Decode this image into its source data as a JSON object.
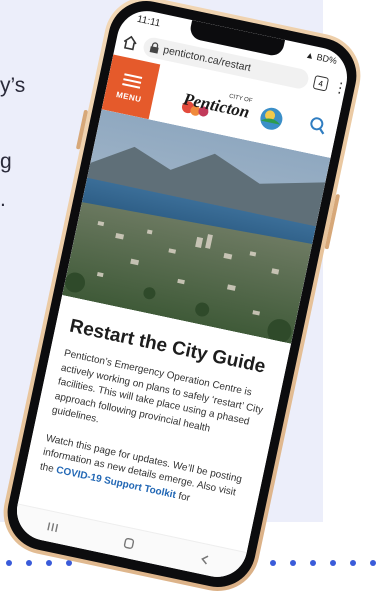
{
  "background": {
    "panel_color": "#eceefa",
    "dot_color": "#3a5bd9",
    "side_text_fragments": [
      "y’s",
      "g",
      "."
    ]
  },
  "phone": {
    "status_bar": {
      "time": "11:11",
      "battery": "BD%"
    },
    "browser": {
      "url": "penticton.ca/restart",
      "tab_count": "4"
    },
    "site_header": {
      "menu_label": "MENU",
      "logo_small_text": "CITY OF",
      "logo_text": "Penticton",
      "accent_color": "#e55a2b"
    },
    "page": {
      "title": "Restart the City Guide",
      "paragraph1": "Penticton’s Emergency Operation Centre is actively working on plans to safely ‘restart’ City facilities. This will take place using a phased approach following provincial health guidelines.",
      "paragraph2_prefix": "Watch this page for updates. We’ll be posting information as new details emerge. Also visit the ",
      "paragraph2_link": "COVID-19 Support Toolkit",
      "paragraph2_suffix": " for"
    }
  }
}
